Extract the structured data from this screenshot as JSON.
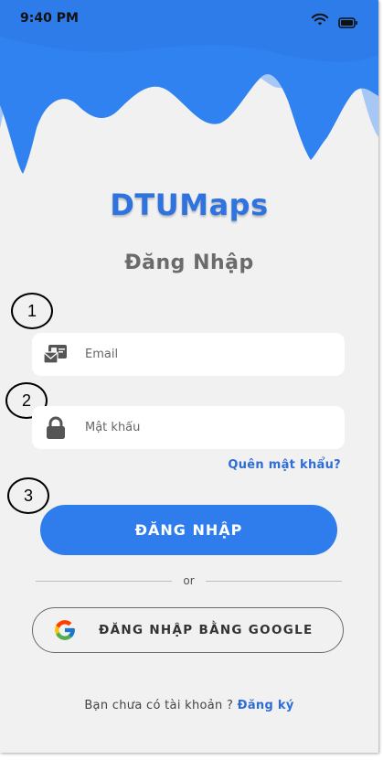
{
  "status_bar": {
    "time": "9:40 PM",
    "wifi_icon": "wifi-icon",
    "battery_icon": "battery-icon"
  },
  "app": {
    "logo": "DTUMaps"
  },
  "login": {
    "title": "Đăng Nhập",
    "email_placeholder": "Email",
    "password_placeholder": "Mật khẩu",
    "forgot_label": "Quên mật khẩu?",
    "submit_label": "ĐĂNG NHẬP",
    "or_label": "or",
    "google_label": "ĐĂNG NHẬP BẰNG GOOGLE",
    "signup_prompt": "Bạn chưa có tài khoản ?",
    "signup_link": "Đăng ký"
  },
  "annotations": [
    "1",
    "2",
    "3"
  ],
  "colors": {
    "primary": "#2f7ded",
    "link": "#2f6dd6",
    "wave_dark": "#2f82ef",
    "wave_light": "#a7c8f5",
    "background": "#f1f1f1"
  }
}
